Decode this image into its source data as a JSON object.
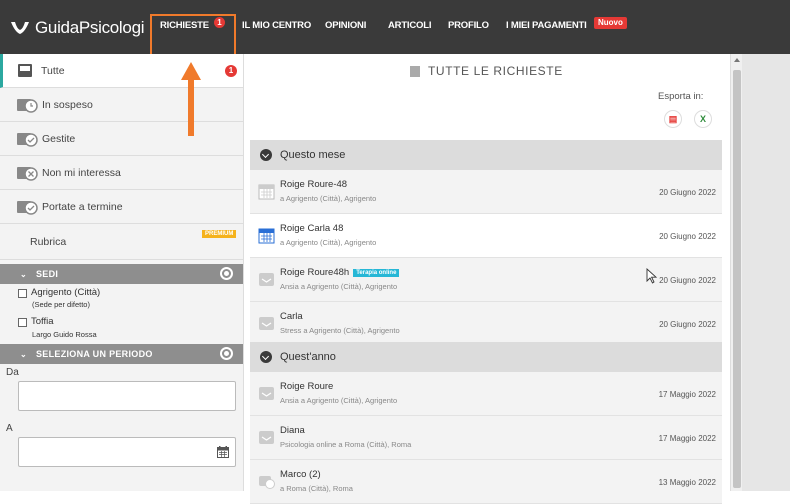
{
  "header": {
    "logo": "GuidaPsicologi",
    "nav": [
      {
        "label": "RICHIESTE",
        "badge": "1"
      },
      {
        "label": "IL MIO CENTRO"
      },
      {
        "label": "OPINIONI"
      },
      {
        "label": "ARTICOLI"
      },
      {
        "label": "PROFILO"
      },
      {
        "label": "I MIEI PAGAMENTI",
        "new_badge": "Nuovo"
      }
    ]
  },
  "sidebar": {
    "items": [
      {
        "label": "Tutte",
        "badge": "1"
      },
      {
        "label": "In sospeso"
      },
      {
        "label": "Gestite"
      },
      {
        "label": "Non mi interessa"
      },
      {
        "label": "Portate a termine"
      },
      {
        "label": "Rubrica",
        "premium": "PREMIUM"
      }
    ],
    "sedi": {
      "title": "SEDI",
      "options": [
        {
          "label": "Agrigento (Città)",
          "sub": "(Sede per difetto)"
        },
        {
          "label": "Toffia",
          "sub": "Largo Guido Rossa"
        }
      ]
    },
    "period": {
      "title": "SELEZIONA UN PERIODO",
      "from_label": "Da",
      "to_label": "A"
    }
  },
  "main": {
    "title": "TUTTE LE RICHIESTE",
    "export_label": "Esporta in:",
    "groups": [
      {
        "title": "Questo mese",
        "requests": [
          {
            "name": "Roige Roure-48",
            "sub": "a Agrigento (Città), Agrigento",
            "date": "20 Giugno 2022",
            "style": "grey"
          },
          {
            "name": "Roige Carla 48",
            "sub": "a Agrigento (Città), Agrigento",
            "date": "20 Giugno 2022",
            "style": "white"
          },
          {
            "name": "Roige Roure48h",
            "tag": "Terapia online",
            "sub": "Ansia a Agrigento (Città), Agrigento",
            "date": "20 Giugno 2022",
            "style": "grey"
          },
          {
            "name": "Carla",
            "sub": "Stress a Agrigento (Città), Agrigento",
            "date": "20 Giugno 2022",
            "style": "grey"
          }
        ]
      },
      {
        "title": "Quest'anno",
        "requests": [
          {
            "name": "Roige Roure",
            "sub": "Ansia a Agrigento (Città), Agrigento",
            "date": "17 Maggio 2022",
            "style": "grey"
          },
          {
            "name": "Diana",
            "sub": "Psicologia online a Roma (Città), Roma",
            "date": "17 Maggio 2022",
            "style": "grey"
          },
          {
            "name": "Marco (2)",
            "sub": "a Roma (Città), Roma",
            "date": "13 Maggio 2022",
            "style": "grey"
          }
        ]
      }
    ]
  },
  "colors": {
    "accent": "#2ba8a0",
    "alert": "#e53935",
    "annotation": "#f07a2b",
    "topbar": "#3a3a3a"
  }
}
